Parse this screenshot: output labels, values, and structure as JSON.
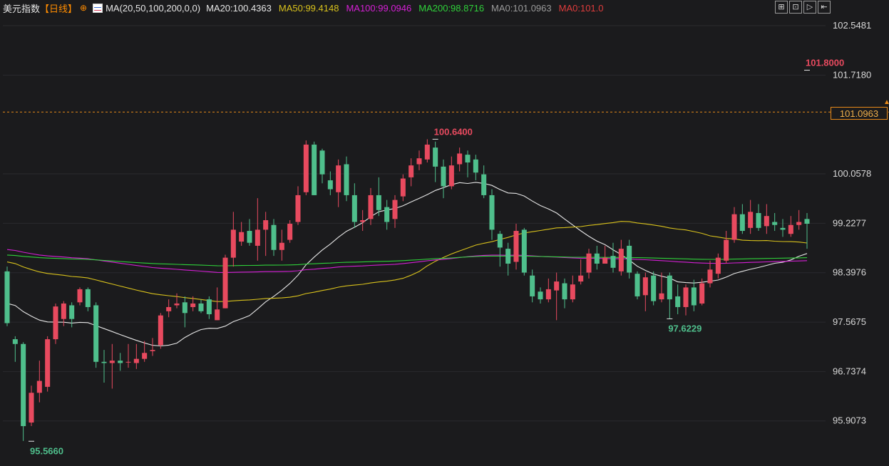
{
  "header": {
    "symbol": "美元指数",
    "period": "【日线】",
    "crosshair_icon": "crosshair-icon",
    "ma_icon": "ma-indicator-icon",
    "ma_params": "MA(20,50,100,200,0,0)",
    "ma_values": [
      {
        "text": "MA20:100.4363",
        "color": "#e6e6e6"
      },
      {
        "text": "MA50:99.4148",
        "color": "#d9c21c"
      },
      {
        "text": "MA100:99.0946",
        "color": "#d61fd6"
      },
      {
        "text": "MA200:98.8716",
        "color": "#2fd13a"
      },
      {
        "text": "MA0:101.0963",
        "color": "#9a9a9a"
      },
      {
        "text": "MA0:101.0",
        "color": "#e03c3c"
      }
    ]
  },
  "toolbar": [
    {
      "name": "zoom-in-button",
      "glyph": "⊞"
    },
    {
      "name": "zoom-out-button",
      "glyph": "⊡"
    },
    {
      "name": "play-button",
      "glyph": "▷"
    },
    {
      "name": "fullscreen-button",
      "glyph": "⇤"
    }
  ],
  "colors": {
    "up": "#e84a5f",
    "down": "#4fbf8c",
    "grid": "#2b2b2e",
    "axis_text": "#d8d8d8",
    "current_line": "#e88a1a"
  },
  "current_price": "101.0963",
  "chart_data": {
    "type": "candlestick",
    "y_ticks": [
      "102.5481",
      "101.7180",
      "100.0578",
      "99.2277",
      "98.3976",
      "97.5675",
      "96.7374",
      "95.9073"
    ],
    "ylim": [
      95.15,
      102.74
    ],
    "annotations": [
      {
        "text": "101.8000",
        "value": 101.8,
        "index": 99,
        "color": "#e84a5f",
        "position": "above"
      },
      {
        "text": "100.6400",
        "value": 100.64,
        "index": 53,
        "color": "#e84a5f",
        "position": "above"
      },
      {
        "text": "97.6229",
        "value": 97.6229,
        "index": 82,
        "color": "#4fbf8c",
        "position": "below"
      },
      {
        "text": "95.5660",
        "value": 95.566,
        "index": 3,
        "color": "#4fbf8c",
        "position": "below"
      }
    ],
    "candles": [
      [
        98.42,
        97.55,
        98.5,
        97.5
      ],
      [
        97.28,
        97.2,
        97.33,
        96.9
      ],
      [
        97.2,
        95.82,
        97.23,
        95.57
      ],
      [
        95.88,
        96.38,
        96.5,
        95.82
      ],
      [
        96.38,
        96.58,
        96.92,
        96.22
      ],
      [
        96.48,
        97.28,
        97.33,
        96.4
      ],
      [
        97.28,
        97.83,
        97.88,
        97.2
      ],
      [
        97.62,
        97.88,
        97.92,
        97.5
      ],
      [
        97.85,
        97.62,
        97.9,
        97.48
      ],
      [
        97.9,
        98.12,
        98.15,
        97.85
      ],
      [
        98.12,
        97.82,
        98.15,
        97.75
      ],
      [
        97.85,
        96.9,
        97.9,
        96.8
      ],
      [
        96.9,
        96.88,
        97.1,
        96.55
      ],
      [
        96.88,
        96.92,
        97.2,
        96.45
      ],
      [
        96.92,
        96.88,
        97.05,
        96.75
      ],
      [
        96.9,
        96.9,
        97.2,
        96.8
      ],
      [
        96.88,
        96.95,
        97.2,
        96.78
      ],
      [
        96.95,
        97.05,
        97.25,
        96.9
      ],
      [
        97.08,
        97.1,
        97.3,
        97.0
      ],
      [
        97.18,
        97.68,
        97.72,
        97.12
      ],
      [
        97.75,
        97.82,
        97.95,
        97.65
      ],
      [
        97.85,
        97.88,
        98.05,
        97.8
      ],
      [
        97.9,
        97.72,
        98.0,
        97.48
      ],
      [
        97.82,
        97.88,
        98.0,
        97.75
      ],
      [
        97.88,
        97.75,
        97.95,
        97.72
      ],
      [
        97.95,
        97.7,
        98.0,
        97.62
      ],
      [
        97.6,
        97.78,
        98.15,
        97.6
      ],
      [
        97.8,
        98.65,
        98.7,
        97.8
      ],
      [
        98.65,
        99.12,
        99.42,
        98.5
      ],
      [
        98.92,
        99.08,
        99.25,
        98.85
      ],
      [
        99.1,
        98.9,
        99.3,
        98.85
      ],
      [
        98.85,
        99.12,
        99.65,
        98.6
      ],
      [
        99.12,
        99.28,
        99.42,
        98.68
      ],
      [
        99.2,
        98.78,
        99.3,
        98.68
      ],
      [
        98.78,
        98.9,
        99.12,
        98.6
      ],
      [
        98.95,
        99.22,
        99.28,
        98.9
      ],
      [
        99.25,
        99.7,
        99.85,
        99.2
      ],
      [
        99.75,
        100.55,
        100.62,
        99.7
      ],
      [
        100.55,
        99.7,
        100.6,
        99.7
      ],
      [
        100.45,
        100.05,
        100.48,
        99.9
      ],
      [
        99.95,
        99.8,
        100.1,
        99.7
      ],
      [
        99.75,
        100.2,
        100.3,
        99.5
      ],
      [
        100.22,
        99.7,
        100.35,
        99.6
      ],
      [
        99.7,
        99.25,
        99.9,
        99.15
      ],
      [
        99.25,
        99.28,
        99.45,
        99.1
      ],
      [
        99.3,
        99.7,
        99.82,
        99.2
      ],
      [
        99.7,
        99.45,
        100.0,
        99.35
      ],
      [
        99.5,
        99.25,
        99.62,
        99.12
      ],
      [
        99.3,
        99.62,
        99.7,
        99.15
      ],
      [
        99.68,
        99.98,
        100.05,
        99.6
      ],
      [
        100.0,
        100.2,
        100.32,
        99.85
      ],
      [
        100.22,
        100.32,
        100.45,
        100.12
      ],
      [
        100.3,
        100.55,
        100.64,
        100.25
      ],
      [
        100.5,
        100.18,
        100.6,
        99.92
      ],
      [
        100.18,
        99.85,
        100.3,
        99.65
      ],
      [
        99.85,
        100.2,
        100.35,
        99.8
      ],
      [
        100.22,
        100.4,
        100.5,
        100.1
      ],
      [
        100.38,
        100.25,
        100.45,
        100.0
      ],
      [
        100.3,
        100.08,
        100.38,
        99.95
      ],
      [
        100.05,
        99.7,
        100.2,
        99.65
      ],
      [
        99.7,
        99.12,
        99.8,
        98.95
      ],
      [
        99.05,
        98.82,
        99.1,
        98.5
      ],
      [
        98.8,
        98.55,
        98.9,
        98.35
      ],
      [
        98.58,
        99.1,
        99.22,
        98.45
      ],
      [
        99.12,
        98.4,
        99.15,
        98.35
      ],
      [
        98.35,
        98.0,
        98.45,
        97.9
      ],
      [
        98.08,
        97.95,
        98.15,
        97.88
      ],
      [
        97.95,
        98.12,
        98.3,
        97.9
      ],
      [
        98.1,
        98.25,
        98.4,
        97.6
      ],
      [
        98.22,
        97.95,
        98.3,
        97.8
      ],
      [
        97.95,
        98.2,
        98.35,
        97.9
      ],
      [
        98.25,
        98.35,
        98.62,
        98.2
      ],
      [
        98.4,
        98.72,
        98.8,
        98.3
      ],
      [
        98.72,
        98.55,
        98.85,
        98.45
      ],
      [
        98.55,
        98.65,
        98.85,
        98.55
      ],
      [
        98.68,
        98.48,
        98.9,
        98.4
      ],
      [
        98.42,
        98.8,
        98.95,
        98.35
      ],
      [
        98.85,
        98.4,
        98.95,
        98.3
      ],
      [
        98.38,
        98.0,
        98.42,
        97.95
      ],
      [
        98.02,
        98.32,
        98.4,
        97.75
      ],
      [
        98.35,
        97.92,
        98.42,
        97.85
      ],
      [
        97.95,
        98.05,
        98.4,
        97.9
      ],
      [
        98.35,
        97.95,
        98.4,
        97.62
      ],
      [
        98.0,
        97.82,
        98.2,
        97.7
      ],
      [
        97.82,
        98.15,
        98.2,
        97.68
      ],
      [
        98.15,
        97.85,
        98.28,
        97.75
      ],
      [
        97.88,
        98.22,
        98.3,
        97.85
      ],
      [
        98.22,
        98.45,
        98.6,
        98.15
      ],
      [
        98.38,
        98.65,
        98.72,
        98.3
      ],
      [
        98.6,
        98.95,
        99.1,
        98.55
      ],
      [
        98.95,
        99.38,
        99.5,
        98.9
      ],
      [
        99.38,
        99.1,
        99.55,
        99.05
      ],
      [
        99.15,
        99.42,
        99.62,
        99.05
      ],
      [
        99.4,
        99.15,
        99.55,
        99.1
      ],
      [
        99.18,
        99.35,
        99.55,
        99.05
      ],
      [
        99.25,
        99.2,
        99.4,
        99.1
      ],
      [
        99.15,
        99.12,
        99.3,
        99.0
      ],
      [
        99.05,
        99.2,
        99.35,
        99.0
      ],
      [
        99.2,
        99.25,
        99.45,
        99.12
      ],
      [
        99.3,
        99.22,
        99.4,
        98.8
      ]
    ]
  }
}
